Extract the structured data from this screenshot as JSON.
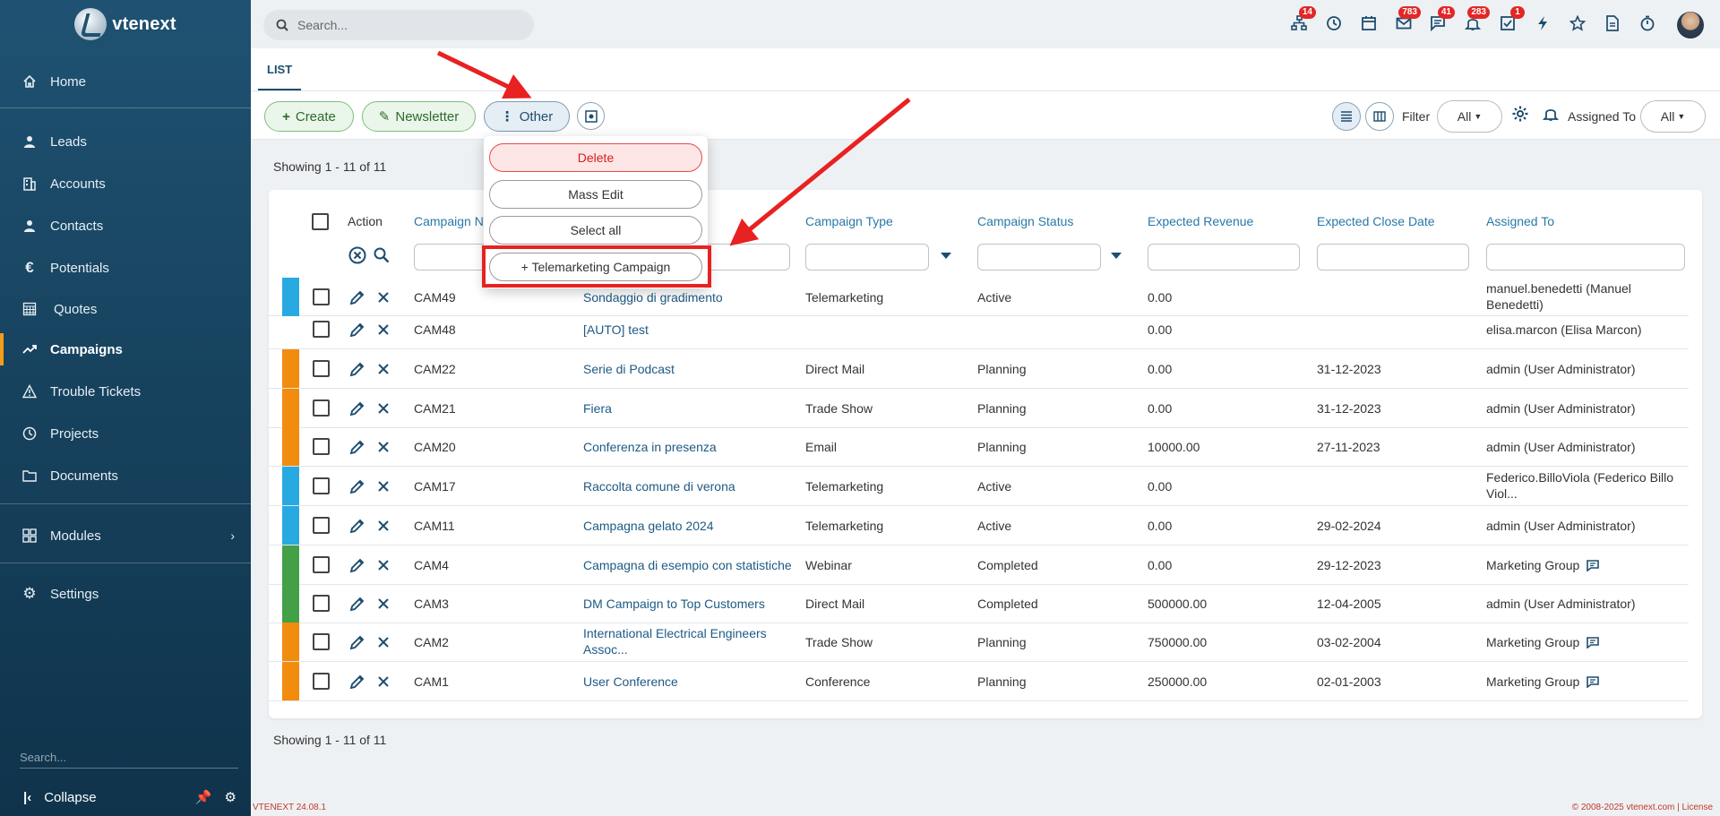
{
  "app": {
    "name": "vtenext",
    "version": "VTENEXT 24.08.1",
    "copyright": "© 2008-2025 vtenext.com | License"
  },
  "sidebar": {
    "items": [
      {
        "label": "Home",
        "icon": "home-icon"
      },
      {
        "label": "Leads",
        "icon": "person-icon"
      },
      {
        "label": "Accounts",
        "icon": "building-icon"
      },
      {
        "label": "Contacts",
        "icon": "person-icon"
      },
      {
        "label": "Potentials",
        "icon": "euro-icon"
      },
      {
        "label": "Quotes",
        "icon": "calculator-icon"
      },
      {
        "label": "Campaigns",
        "icon": "trend-icon",
        "active": true
      },
      {
        "label": "Trouble Tickets",
        "icon": "warning-icon"
      },
      {
        "label": "Projects",
        "icon": "clock-icon"
      },
      {
        "label": "Documents",
        "icon": "folder-icon"
      }
    ],
    "modules_label": "Modules",
    "settings_label": "Settings",
    "search_placeholder": "Search...",
    "collapse_label": "Collapse"
  },
  "header": {
    "search_placeholder": "Search...",
    "badges": {
      "network": "14",
      "mail": "783",
      "chat": "41",
      "bell": "283",
      "tasks": "1"
    }
  },
  "tabs": {
    "list": "LIST"
  },
  "toolbar": {
    "create": "Create",
    "newsletter": "Newsletter",
    "other": "Other",
    "filter_label": "Filter",
    "filter_value": "All",
    "assigned_label": "Assigned To",
    "assigned_value": "All"
  },
  "dropdown": {
    "delete": "Delete",
    "mass_edit": "Mass Edit",
    "select_all": "Select all",
    "telemarketing": "+ Telemarketing Campaign"
  },
  "list": {
    "showing": "Showing 1 - 11 of 11",
    "columns": {
      "action": "Action",
      "campaign_no": "Campaign No",
      "campaign_type": "Campaign Type",
      "campaign_status": "Campaign Status",
      "expected_revenue": "Expected Revenue",
      "expected_close_date": "Expected Close Date",
      "assigned_to": "Assigned To"
    },
    "rows": [
      {
        "no": "CAM49",
        "name": "Sondaggio di gradimento",
        "type": "Telemarketing",
        "status": "Active",
        "revenue": "0.00",
        "close": "",
        "assigned": "manuel.benedetti (Manuel Benedetti)",
        "color": "#29a9e1"
      },
      {
        "no": "CAM48",
        "name": "[AUTO] test",
        "type": "",
        "status": "",
        "revenue": "0.00",
        "close": "",
        "assigned": "elisa.marcon (Elisa Marcon)",
        "color": ""
      },
      {
        "no": "CAM22",
        "name": "Serie di Podcast",
        "type": "Direct Mail",
        "status": "Planning",
        "revenue": "0.00",
        "close": "31-12-2023",
        "assigned": "admin (User Administrator)",
        "color": "#f28c0f"
      },
      {
        "no": "CAM21",
        "name": "Fiera",
        "type": "Trade Show",
        "status": "Planning",
        "revenue": "0.00",
        "close": "31-12-2023",
        "assigned": "admin (User Administrator)",
        "color": "#f28c0f"
      },
      {
        "no": "CAM20",
        "name": "Conferenza in presenza",
        "type": "Email",
        "status": "Planning",
        "revenue": "10000.00",
        "close": "27-11-2023",
        "assigned": "admin (User Administrator)",
        "color": "#f28c0f"
      },
      {
        "no": "CAM17",
        "name": "Raccolta comune di verona",
        "type": "Telemarketing",
        "status": "Active",
        "revenue": "0.00",
        "close": "",
        "assigned": "Federico.BilloViola (Federico Billo Viol...",
        "color": "#29a9e1"
      },
      {
        "no": "CAM11",
        "name": "Campagna gelato 2024",
        "type": "Telemarketing",
        "status": "Active",
        "revenue": "0.00",
        "close": "29-02-2024",
        "assigned": "admin (User Administrator)",
        "color": "#29a9e1"
      },
      {
        "no": "CAM4",
        "name": "Campagna di esempio con statistiche",
        "type": "Webinar",
        "status": "Completed",
        "revenue": "0.00",
        "close": "29-12-2023",
        "assigned": "Marketing Group",
        "color": "#43a047",
        "group": true
      },
      {
        "no": "CAM3",
        "name": "DM Campaign to Top Customers",
        "type": "Direct Mail",
        "status": "Completed",
        "revenue": "500000.00",
        "close": "12-04-2005",
        "assigned": "admin (User Administrator)",
        "color": "#43a047"
      },
      {
        "no": "CAM2",
        "name": "International Electrical Engineers Assoc...",
        "type": "Trade Show",
        "status": "Planning",
        "revenue": "750000.00",
        "close": "03-02-2004",
        "assigned": "Marketing Group",
        "color": "#f28c0f",
        "group": true
      },
      {
        "no": "CAM1",
        "name": "User Conference",
        "type": "Conference",
        "status": "Planning",
        "revenue": "250000.00",
        "close": "02-01-2003",
        "assigned": "Marketing Group",
        "color": "#f28c0f",
        "group": true
      }
    ]
  },
  "colors": {
    "annotation": "#e82121",
    "accent": "#1d4d6e",
    "active_marker": "#f59c1a"
  }
}
